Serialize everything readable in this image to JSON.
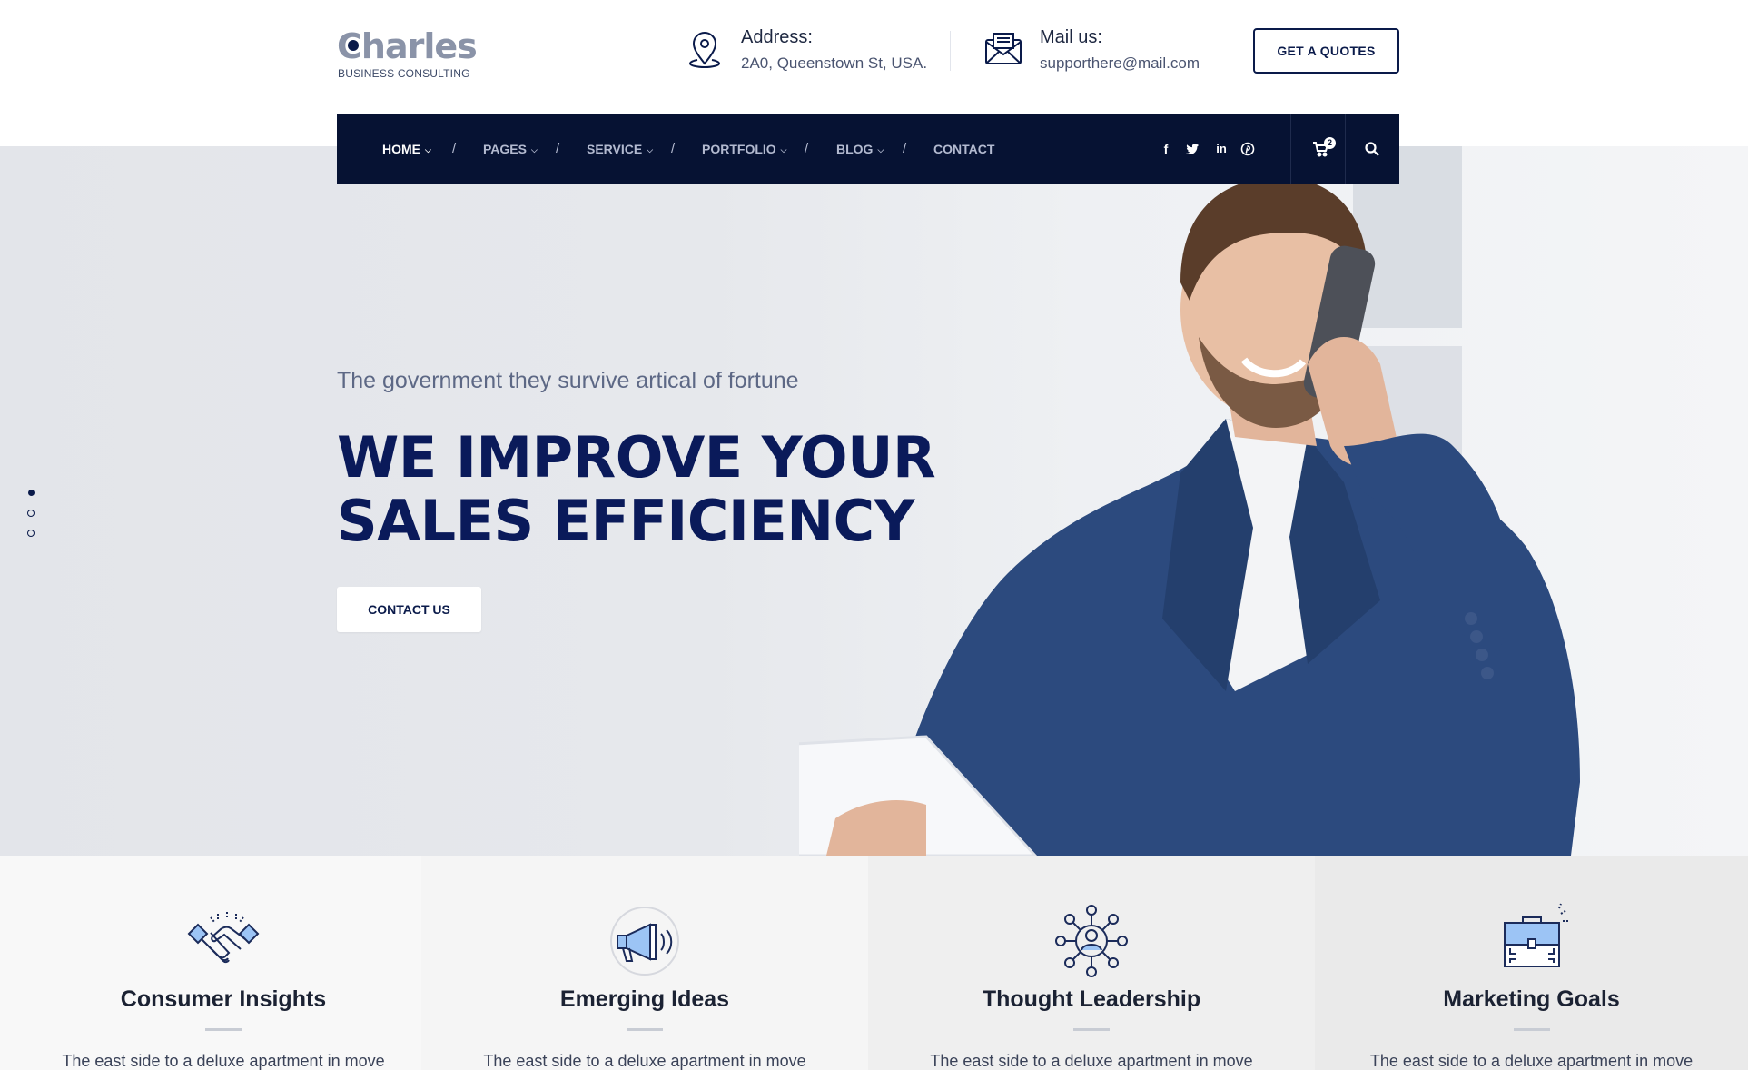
{
  "brand": {
    "name": "Charles",
    "tagline": "BUSINESS CONSULTING"
  },
  "header": {
    "address": {
      "label": "Address:",
      "value": "2A0, Queenstown St, USA."
    },
    "mail": {
      "label": "Mail us:",
      "value": "supporthere@mail.com"
    },
    "quote_button": "GET A QUOTES"
  },
  "nav": {
    "items": [
      {
        "label": "HOME",
        "active": true,
        "dropdown": true
      },
      {
        "label": "PAGES",
        "active": false,
        "dropdown": true
      },
      {
        "label": "SERVICE",
        "active": false,
        "dropdown": true
      },
      {
        "label": "PORTFOLIO",
        "active": false,
        "dropdown": true
      },
      {
        "label": "BLOG",
        "active": false,
        "dropdown": true
      },
      {
        "label": "CONTACT",
        "active": false,
        "dropdown": false
      }
    ],
    "separator": "/",
    "social": [
      "facebook-icon",
      "twitter-icon",
      "linkedin-icon",
      "pinterest-icon"
    ],
    "cart_count": "2"
  },
  "hero": {
    "subtitle": "The government they survive artical of fortune",
    "title_line1": "WE IMPROVE YOUR",
    "title_line2": "SALES EFFICIENCY",
    "button": "CONTACT US",
    "slides": 3,
    "active_slide": 1
  },
  "features": [
    {
      "icon": "handshake-icon",
      "title": "Consumer Insights",
      "text": "The east side to a deluxe apartment in move"
    },
    {
      "icon": "megaphone-icon",
      "title": "Emerging Ideas",
      "text": "The east side to a deluxe apartment in move"
    },
    {
      "icon": "network-people-icon",
      "title": "Thought Leadership",
      "text": "The east side to a deluxe apartment in move"
    },
    {
      "icon": "briefcase-icon",
      "title": "Marketing Goals",
      "text": "The east side to a deluxe apartment in move"
    }
  ],
  "colors": {
    "navy": "#061233",
    "title_blue": "#0a1a5a",
    "accent_blue": "#9cc4f5"
  }
}
